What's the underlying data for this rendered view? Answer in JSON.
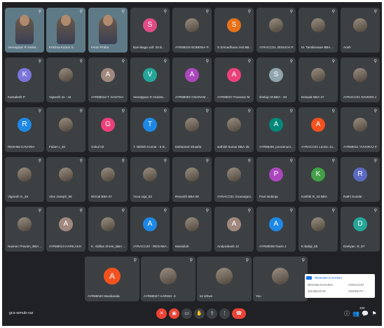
{
  "participants_row1": [
    {
      "name": "Veerappan R Assist...",
      "kind": "video"
    },
    {
      "name": "Krishna Kumar S",
      "kind": "video"
    },
    {
      "name": "Imran Prabu",
      "kind": "video"
    },
    {
      "name": "Barnikaga vaif. 26 B...",
      "initial": "S",
      "color": "#e04c86"
    },
    {
      "name": "AYR88016 BOBENIA P...",
      "kind": "photo"
    },
    {
      "name": "S.Srimadhana 2nd BB...",
      "initial": "S",
      "color": "#e8711a"
    },
    {
      "name": "AYRACC01 JENUGH P...",
      "kind": "photo"
    },
    {
      "name": "M. Tamilarasan BBA ...",
      "kind": "photo"
    },
    {
      "name": "Aneh",
      "kind": "photo"
    }
  ],
  "participants_row2": [
    {
      "name": "Kamalesh P",
      "initial": "K",
      "color": "#7b74d9"
    },
    {
      "name": "Vignesh ss - 44",
      "kind": "photo"
    },
    {
      "name": "AYR88013 T. SASTHA",
      "initial": "A",
      "color": "#a1887f"
    },
    {
      "name": "Veerappan R Assista...",
      "initial": "V",
      "color": "#26a69a"
    },
    {
      "name": "AYR88092 GNANAM...",
      "initial": "A",
      "color": "#ab47bc"
    },
    {
      "name": "AYR88037 Pavarani M",
      "initial": "A",
      "color": "#ec407a"
    },
    {
      "name": "shelujo M BBA - 20",
      "initial": "S",
      "color": "#90a4ae"
    },
    {
      "name": "Deepak BBA 37",
      "kind": "photo"
    },
    {
      "name": "AYRACC01 NAVEEN J",
      "kind": "photo"
    }
  ],
  "participants_row3": [
    {
      "name": "RESHMI KAVARIA",
      "initial": "R",
      "color": "#1e88e5"
    },
    {
      "name": "Falam I_33",
      "kind": "photo"
    },
    {
      "name": "Gokul 02",
      "initial": "G",
      "color": "#ec407a"
    },
    {
      "name": "T. Nithish Kumar - 6 B...",
      "initial": "T",
      "color": "#1e88e5"
    },
    {
      "name": "Mohamed Shaafia",
      "kind": "photo"
    },
    {
      "name": "sathish kumar BBA-35",
      "kind": "photo"
    },
    {
      "name": "AYR88491 pooramuni...",
      "initial": "A",
      "color": "#00897b"
    },
    {
      "name": "AYRACC01 Leonic Ja...",
      "initial": "A",
      "color": "#f4511e"
    },
    {
      "name": "AYR88011 YUVARAJ P",
      "kind": "photo"
    }
  ],
  "participants_row4": [
    {
      "name": "Vignesh G_49",
      "kind": "photo"
    },
    {
      "name": "Alex Joseph_06",
      "kind": "photo"
    },
    {
      "name": "Nirmal BBA 07",
      "kind": "photo"
    },
    {
      "name": "Yuva raja_53",
      "kind": "photo"
    },
    {
      "name": "Revanth BBA 09",
      "kind": "photo"
    },
    {
      "name": "AYRACC01 Gnanarjani...",
      "kind": "photo"
    },
    {
      "name": "Paul Mubinja",
      "initial": "P",
      "color": "#ab47bc"
    },
    {
      "name": "Karthik R_23 BBA",
      "initial": "K",
      "color": "#43a047"
    },
    {
      "name": "Rathi Sundar",
      "initial": "R",
      "color": "#5c6bc0"
    }
  ],
  "participants_row5": [
    {
      "name": "Naveen Pravien_BBA ...",
      "kind": "photo"
    },
    {
      "name": "AYR88014 HARILAKH",
      "initial": "A",
      "color": "#a1887f"
    },
    {
      "name": "K. Abillas Shree_BBA ...",
      "kind": "photo"
    },
    {
      "name": "AYRACC40 - RESHMA...",
      "initial": "A",
      "color": "#1e88e5"
    },
    {
      "name": "Masiullah",
      "kind": "photo"
    },
    {
      "name": "Arulprakash J3",
      "initial": "A",
      "color": "#a1887f"
    },
    {
      "name": "AYR88508 Ravin J",
      "initial": "A",
      "color": "#1e88e5"
    },
    {
      "name": "K.Balaji_69",
      "kind": "photo"
    },
    {
      "name": "Deeiyan. R_57",
      "initial": "D",
      "color": "#26a69a"
    }
  ],
  "participants_row6": [
    {
      "name": "AYR88040 Manikanda",
      "initial": "A",
      "color": "#f4511e"
    },
    {
      "name": "AYR88027 HARISH .K",
      "kind": "photo"
    },
    {
      "name": "s2 sthwe",
      "kind": "photo"
    },
    {
      "name": "You",
      "kind": "photo"
    }
  ],
  "popup": {
    "title": "RESHMA KAVARIA",
    "row1_left": "RESHMI KAVARIA",
    "row1_right": "AYRACC07",
    "row2_left": "315 BDA/CIS",
    "row2_right": "VISHNUTY ..."
  },
  "bottom_bar": {
    "meeting_code": "gcs-wmub-var",
    "participant_count": "100"
  },
  "icons": {
    "mic_off": "mic-off-icon",
    "cam_off": "cam-off-icon",
    "captions": "captions-icon",
    "raise_hand": "raise-hand-icon",
    "present": "present-icon",
    "more": "more-options-icon",
    "end_call": "end-call-icon",
    "info": "info-icon",
    "people": "people-icon",
    "chat": "chat-icon",
    "activities": "activities-icon",
    "lock": "host-controls-icon"
  },
  "colors": {
    "background": "#202124",
    "tile": "#3c4043",
    "end_call": "#ea4335"
  }
}
